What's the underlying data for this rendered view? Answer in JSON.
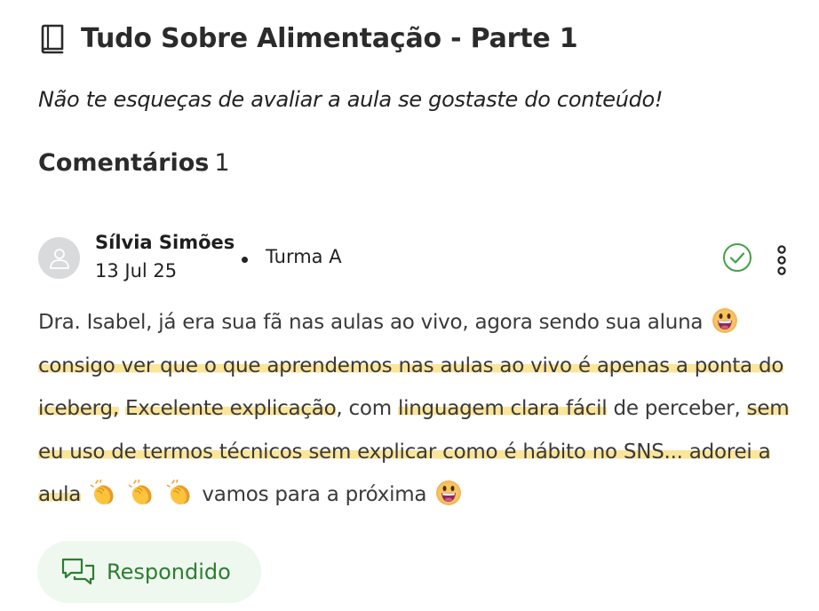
{
  "lesson": {
    "icon": "book-icon",
    "title": "Tudo Sobre Alimentação - Parte 1",
    "reminder": "Não te esqueças de avaliar a aula se gostaste do conteúdo!"
  },
  "comments": {
    "label": "Comentários",
    "count": "1"
  },
  "comment": {
    "author": "Sílvia Simões",
    "date": "13 Jul 25",
    "group": "Turma A",
    "status_icon": "check-circle-icon",
    "menu_icon": "more-vertical-icon",
    "text": {
      "p1": "Dra. Isabel, já era sua fã nas aulas ao vivo, agora sendo sua aluna",
      "h1": "consigo ver que o que aprendemos nas aulas ao vivo é apenas a ponta do iceberg,",
      "h2": "Excelente explicação",
      "p2": ", com",
      "h3": "linguagem clara fácil",
      "p3": "de perceber,",
      "h4": "sem eu uso de termos técnicos sem explicar como é hábito no SNS... adorei a aula",
      "p4": "vamos para a próxima"
    },
    "emojis": [
      "grinning-face-icon",
      "clapping-hands-icon",
      "clapping-hands-icon",
      "clapping-hands-icon",
      "grinning-face-icon"
    ]
  },
  "reply_status": {
    "label": "Respondido",
    "icon": "chat-bubbles-icon"
  },
  "colors": {
    "highlight": "#fbe59a",
    "success": "#2e7d32",
    "check": "#43a047",
    "answered_bg": "#eef8ef"
  }
}
